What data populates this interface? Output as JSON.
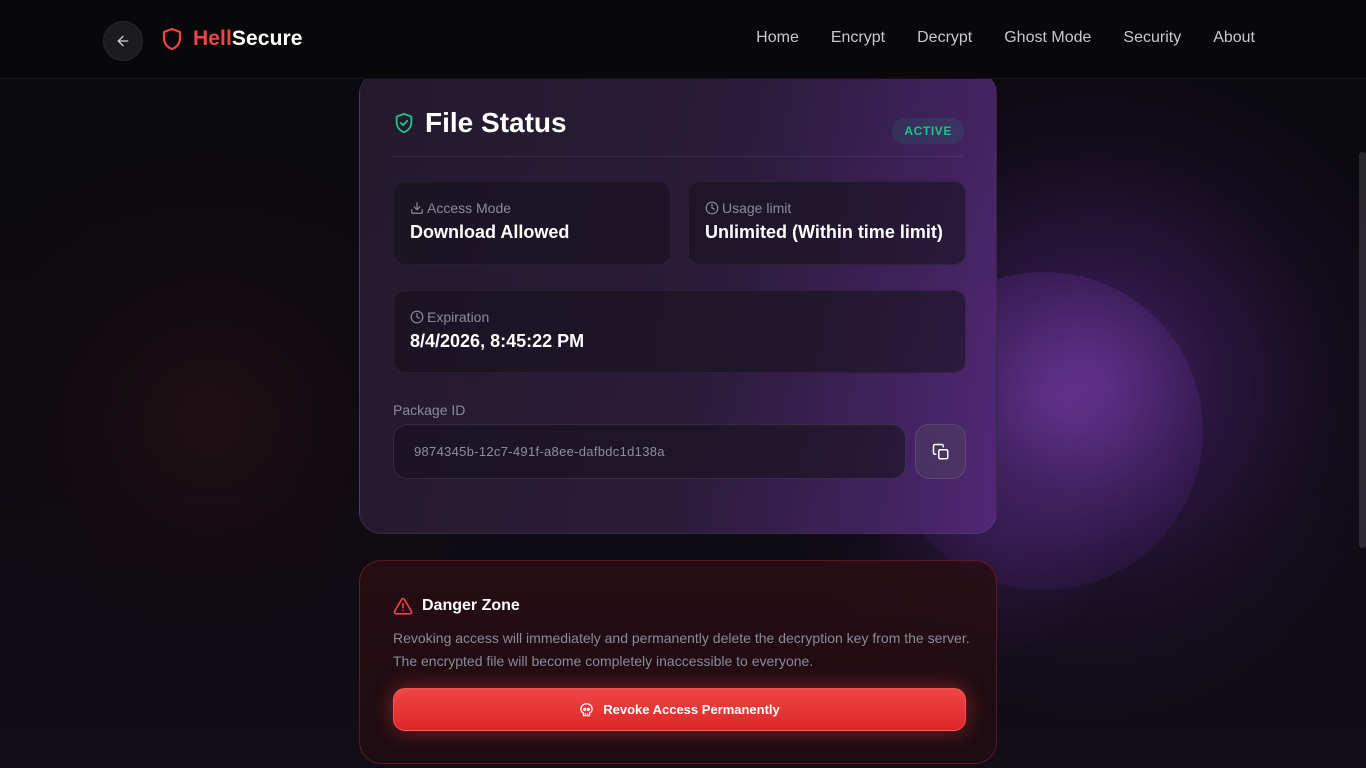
{
  "brand": {
    "name_part1": "Hell",
    "name_part2": "Secure",
    "accent": "#ef4444"
  },
  "nav": {
    "links": [
      "Home",
      "Encrypt",
      "Decrypt",
      "Ghost Mode",
      "Security",
      "About"
    ]
  },
  "file_status": {
    "title": "File Status",
    "badge": "ACTIVE",
    "badge_color": "#22c08a",
    "access_mode": {
      "label": "Access Mode",
      "value": "Download Allowed"
    },
    "usage_limit": {
      "label": "Usage limit",
      "value": "Unlimited (Within time limit)"
    },
    "expiration": {
      "label": "Expiration",
      "value": "8/4/2026, 8:45:22 PM"
    },
    "package_id": {
      "label": "Package ID",
      "value": "9874345b-12c7-491f-a8ee-dafbdc1d138a"
    }
  },
  "danger_zone": {
    "title": "Danger Zone",
    "description": "Revoking access will immediately and permanently delete the decryption key from the server. The encrypted file will become completely inaccessible to everyone.",
    "button_label": "Revoke Access Permanently"
  },
  "icons": {
    "back": "arrow-left-icon",
    "logo": "shield-icon",
    "title": "shield-check-icon",
    "access": "download-icon",
    "usage": "clock-icon",
    "expiration": "clock-icon",
    "copy": "copy-icon",
    "warning": "warning-triangle-icon",
    "revoke": "skull-icon"
  }
}
